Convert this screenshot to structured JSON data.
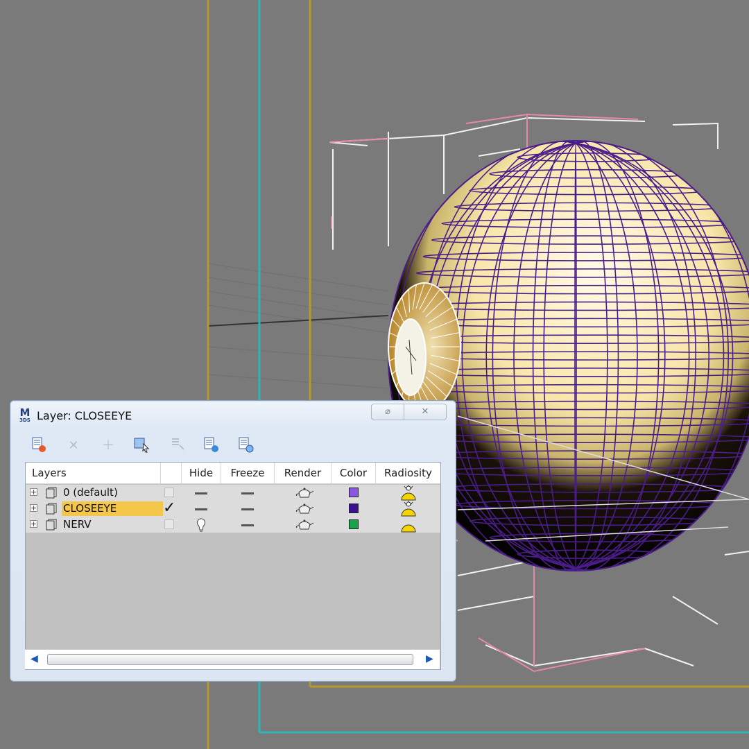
{
  "dialog": {
    "title": "Layer: CLOSEEYE",
    "app_icon_label": "M",
    "app_icon_sub": "3DS"
  },
  "toolbar": [
    {
      "icon": "create-layer-icon",
      "enabled": true
    },
    {
      "icon": "delete-layer-icon",
      "enabled": false
    },
    {
      "icon": "add-to-layer-icon",
      "enabled": false
    },
    {
      "icon": "select-objects-icon",
      "enabled": true
    },
    {
      "icon": "highlight-layer-icon",
      "enabled": false
    },
    {
      "icon": "hide-unhide-all-icon",
      "enabled": true
    },
    {
      "icon": "freeze-unfreeze-all-icon",
      "enabled": true
    }
  ],
  "columns": [
    "Layers",
    "Hide",
    "Freeze",
    "Render",
    "Color",
    "Radiosity"
  ],
  "layers": [
    {
      "name": "0 (default)",
      "current": false,
      "hidden": false,
      "frozen": false,
      "renderable": true,
      "color": "#8a56e0",
      "selected": false
    },
    {
      "name": "CLOSEEYE",
      "current": true,
      "hidden": false,
      "frozen": false,
      "renderable": true,
      "color": "#3a1290",
      "selected": true
    },
    {
      "name": "NERV",
      "current": false,
      "hidden": true,
      "frozen": false,
      "renderable": true,
      "color": "#16a34a",
      "selected": false
    }
  ],
  "colors": {
    "viewport_bg": "#7a7a7a",
    "selection": "#f4c64a",
    "wire_purple": "#4b1d8a",
    "sphere_light": "#fff6d0"
  }
}
